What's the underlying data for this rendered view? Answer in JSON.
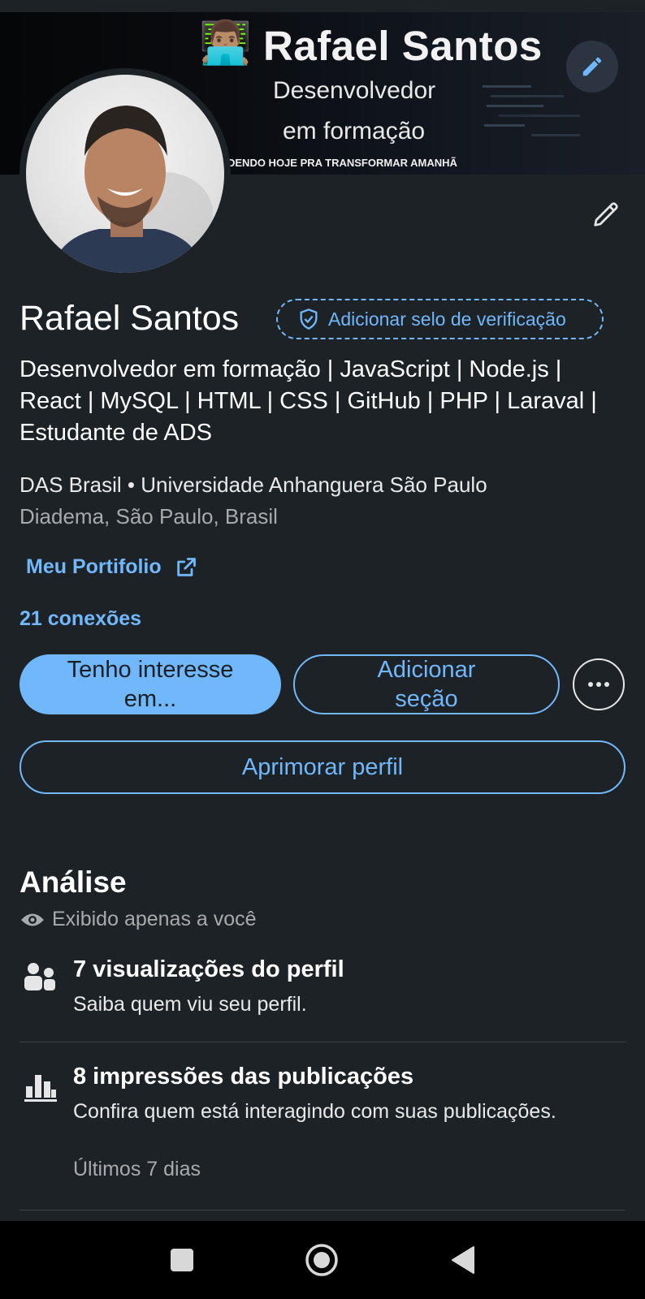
{
  "banner": {
    "emoji": "👨🏽‍💻",
    "title": "Rafael Santos",
    "subtitle_line1": "Desenvolvedor",
    "subtitle_line2": "em formação",
    "slogan": "DENDO HOJE PRA TRANSFORMAR AMANHÃ"
  },
  "profile": {
    "name": "Rafael Santos",
    "verify_label": "Adicionar selo de verificação",
    "headline": "Desenvolvedor em formação | JavaScript | Node.js | React | MySQL | HTML | CSS | GitHub | PHP | Laraval | Estudante de ADS",
    "company": "DAS Brasil • Universidade Anhanguera São Paulo",
    "location": "Diadema, São Paulo, Brasil",
    "portfolio_label": "Meu Portifolio",
    "connections": "21 conexões"
  },
  "actions": {
    "open_to": "Tenho interesse em...",
    "add_section": "Adicionar seção",
    "improve": "Aprimorar perfil"
  },
  "analysis": {
    "title": "Análise",
    "visibility": "Exibido apenas a você",
    "items": [
      {
        "icon": "people-icon",
        "title": "7 visualizações do perfil",
        "desc": "Saiba quem viu seu perfil."
      },
      {
        "icon": "bar-chart-icon",
        "title": "8 impressões das publicações",
        "desc": "Confira quem está interagindo com suas publicações.",
        "meta": "Últimos 7 dias"
      }
    ]
  },
  "colors": {
    "background": "#1d2226",
    "accent": "#71b7fb",
    "secondary_text": "#a9aaab"
  }
}
